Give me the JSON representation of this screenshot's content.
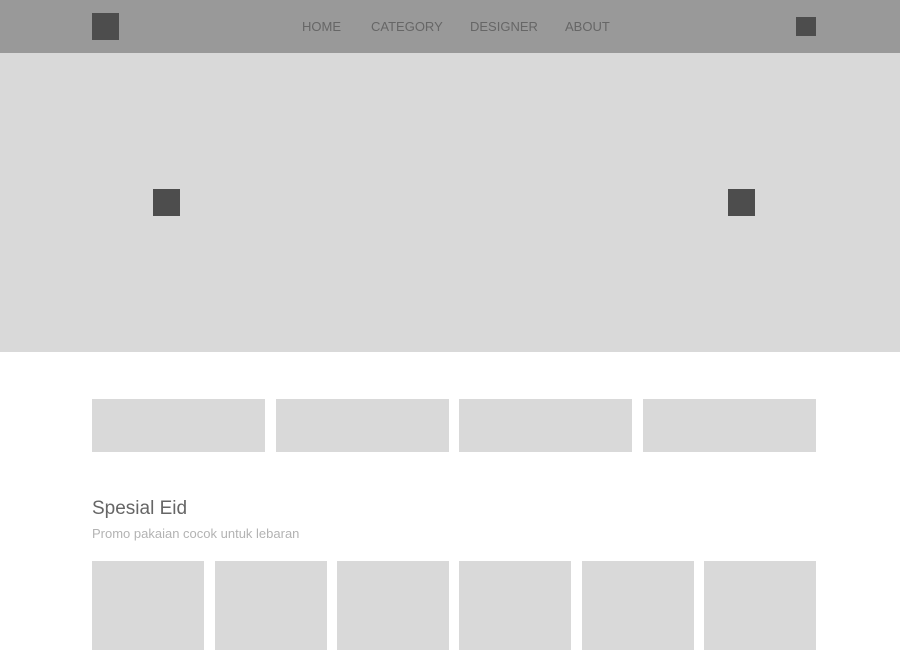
{
  "navbar": {
    "logo_icon": "logo-placeholder",
    "links": [
      {
        "label": "HOME"
      },
      {
        "label": "CATEGORY"
      },
      {
        "label": "DESIGNER"
      },
      {
        "label": "ABOUT"
      }
    ],
    "cart_icon": "cart-placeholder"
  },
  "hero": {
    "prev_icon": "chevron-left-placeholder",
    "next_icon": "chevron-right-placeholder"
  },
  "section": {
    "title": "Spesial Eid",
    "subtitle": "Promo pakaian cocok untuk lebaran"
  },
  "colors": {
    "navbar_bg": "#999999",
    "placeholder_bg": "#d9d9d9",
    "icon_fill": "#4d4d4d",
    "nav_text": "#666666",
    "title_text": "#666666",
    "subtitle_text": "#b3b3b3"
  }
}
